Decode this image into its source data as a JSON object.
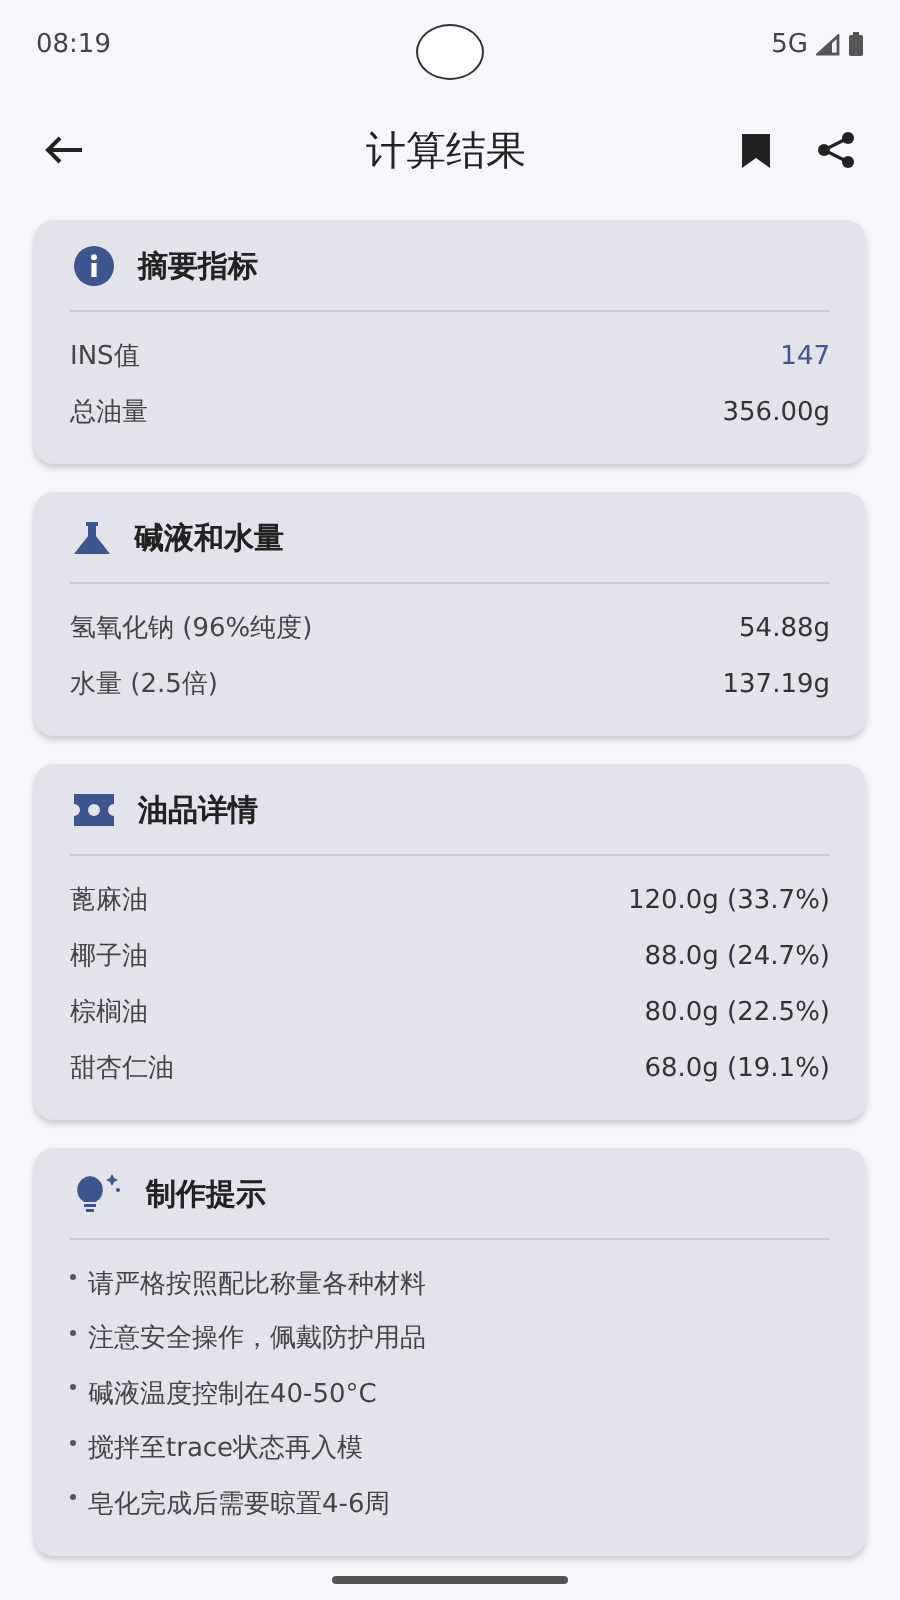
{
  "status_bar": {
    "time": "08:19",
    "network": "5G"
  },
  "app_bar": {
    "title": "计算结果"
  },
  "cards": [
    {
      "kind": "rows",
      "title": "摘要指标",
      "rows": [
        {
          "label": "INS值",
          "value": "147",
          "highlight": true
        },
        {
          "label": "总油量",
          "value": "356.00g",
          "highlight": false
        }
      ]
    },
    {
      "kind": "rows",
      "title": "碱液和水量",
      "rows": [
        {
          "label": "氢氧化钠 (96%纯度)",
          "value": "54.88g",
          "highlight": false
        },
        {
          "label": "水量 (2.5倍)",
          "value": "137.19g",
          "highlight": false
        }
      ]
    },
    {
      "kind": "rows",
      "title": "油品详情",
      "rows": [
        {
          "label": "蓖麻油",
          "value": "120.0g (33.7%)",
          "highlight": false
        },
        {
          "label": "椰子油",
          "value": "88.0g (24.7%)",
          "highlight": false
        },
        {
          "label": "棕榈油",
          "value": "80.0g (22.5%)",
          "highlight": false
        },
        {
          "label": "甜杏仁油",
          "value": "68.0g (19.1%)",
          "highlight": false
        }
      ]
    },
    {
      "kind": "tips",
      "title": "制作提示",
      "tips": [
        "请严格按照配比称量各种材料",
        "注意安全操作，佩戴防护用品",
        "碱液温度控制在40-50°C",
        "搅拌至trace状态再入模",
        "皂化完成后需要晾置4-6周"
      ]
    }
  ]
}
